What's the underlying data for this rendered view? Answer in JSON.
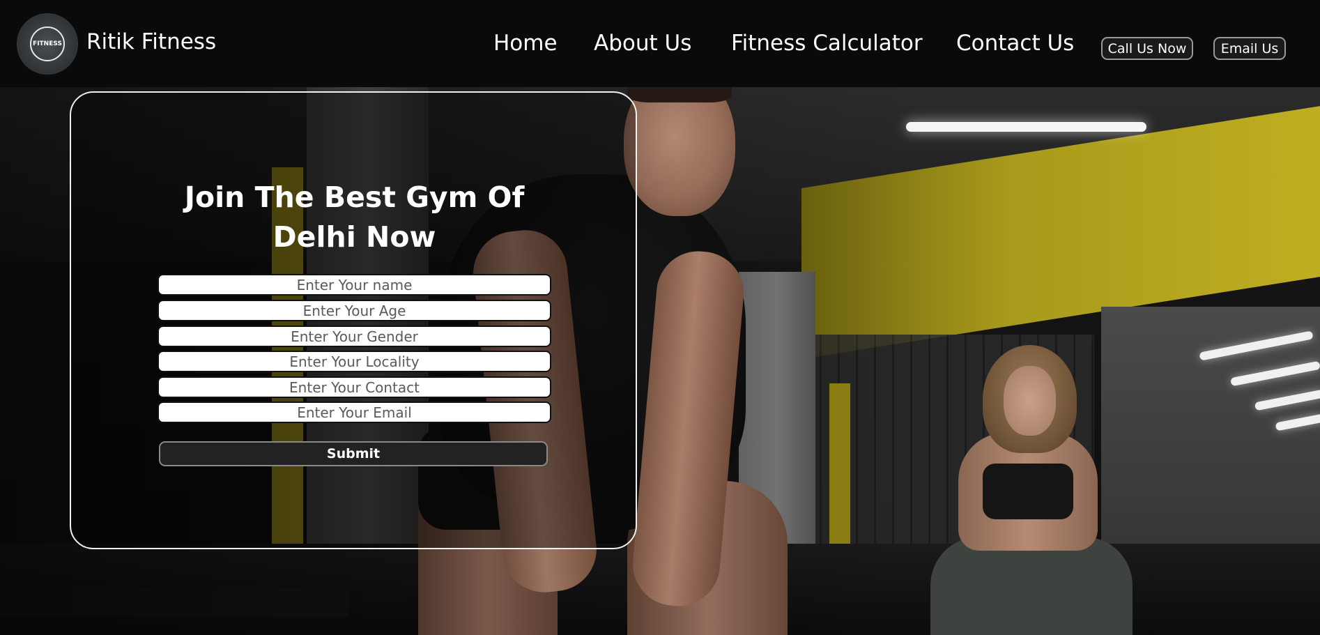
{
  "header": {
    "brand": "Ritik Fitness",
    "logo_text": "FITNESS",
    "nav": [
      {
        "label": "Home"
      },
      {
        "label": "About Us"
      },
      {
        "label": "Fitness Calculator"
      },
      {
        "label": "Contact Us"
      }
    ],
    "call_button": "Call Us Now",
    "email_button": "Email Us"
  },
  "form": {
    "title": "Join The Best Gym Of Delhi Now",
    "fields": [
      {
        "placeholder": "Enter Your name"
      },
      {
        "placeholder": "Enter Your Age"
      },
      {
        "placeholder": "Enter Your Gender"
      },
      {
        "placeholder": "Enter Your Locality"
      },
      {
        "placeholder": "Enter Your Contact"
      },
      {
        "placeholder": "Enter Your Email"
      }
    ],
    "submit_label": "Submit"
  },
  "colors": {
    "navbar_bg": "#0a0a0a",
    "text": "#ffffff",
    "accent_yellow": "#b3a11d",
    "card_border": "#f0f0f0"
  }
}
